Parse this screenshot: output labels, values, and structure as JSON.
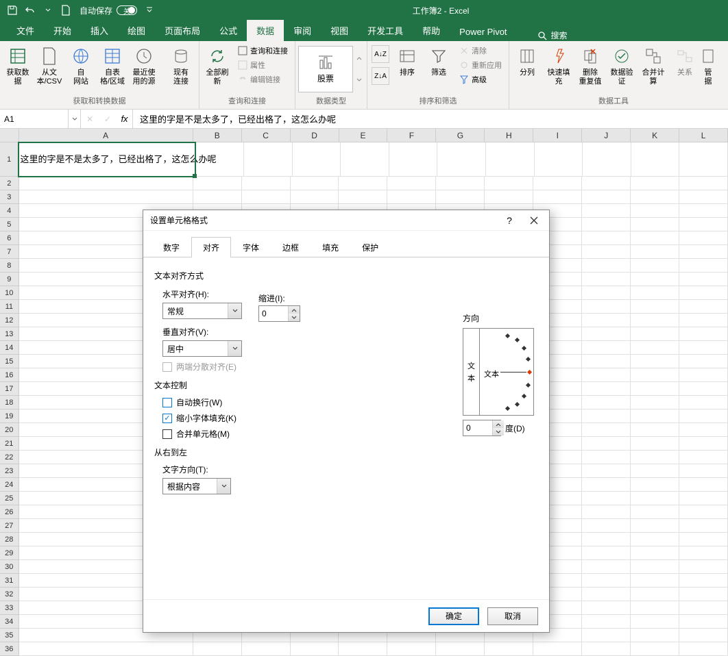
{
  "titlebar": {
    "autosave_label": "自动保存",
    "autosave_state": "关",
    "title": "工作簿2 - Excel"
  },
  "ribbon_tabs": [
    "文件",
    "开始",
    "插入",
    "绘图",
    "页面布局",
    "公式",
    "数据",
    "审阅",
    "视图",
    "开发工具",
    "帮助",
    "Power Pivot"
  ],
  "active_tab_index": 6,
  "search_label": "搜索",
  "ribbon": {
    "group1": {
      "label": "获取和转换数据",
      "items": [
        "获取数\n据",
        "从文\n本/CSV",
        "自\n网站",
        "自表\n格/区域",
        "最近使\n用的源",
        "现有\n连接"
      ]
    },
    "group2": {
      "label": "查询和连接",
      "refresh": "全部刷\n新",
      "items": [
        "查询和连接",
        "属性",
        "编辑链接"
      ]
    },
    "group3": {
      "label": "数据类型",
      "stock": "股票"
    },
    "group4": {
      "label": "排序和筛选",
      "sort": "排序",
      "filter": "筛选",
      "clear": "清除",
      "reapply": "重新应用",
      "advanced": "高级"
    },
    "group5": {
      "label": "数据工具",
      "items": [
        "分列",
        "快速填充",
        "删除\n重复值",
        "数据验\n证",
        "合并计算",
        "关系",
        "管\n据"
      ]
    }
  },
  "name_box": "A1",
  "formula_text": "这里的字是不是太多了，已经出格了，这怎么办呢",
  "cell_a1": "这里的字是不是太多了，已经出格了，这怎么办呢",
  "columns": [
    "A",
    "B",
    "C",
    "D",
    "E",
    "F",
    "G",
    "H",
    "I",
    "J",
    "K",
    "L"
  ],
  "dialog": {
    "title": "设置单元格格式",
    "tabs": [
      "数字",
      "对齐",
      "字体",
      "边框",
      "填充",
      "保护"
    ],
    "active_tab_index": 1,
    "text_align_section": "文本对齐方式",
    "h_align_label": "水平对齐(H):",
    "h_align_value": "常规",
    "indent_label": "缩进(I):",
    "indent_value": "0",
    "v_align_label": "垂直对齐(V):",
    "v_align_value": "居中",
    "justify_dist": "两端分散对齐(E)",
    "text_control_section": "文本控制",
    "wrap_text": "自动换行(W)",
    "shrink_fit": "缩小字体填充(K)",
    "merge_cells": "合并单元格(M)",
    "rtl_section": "从右到左",
    "text_dir_label": "文字方向(T):",
    "text_dir_value": "根据内容",
    "orient_section": "方向",
    "orient_vert1": "文",
    "orient_vert2": "本",
    "orient_center": "文本",
    "degree_value": "0",
    "degree_label": "度(D)",
    "ok": "确定",
    "cancel": "取消"
  }
}
